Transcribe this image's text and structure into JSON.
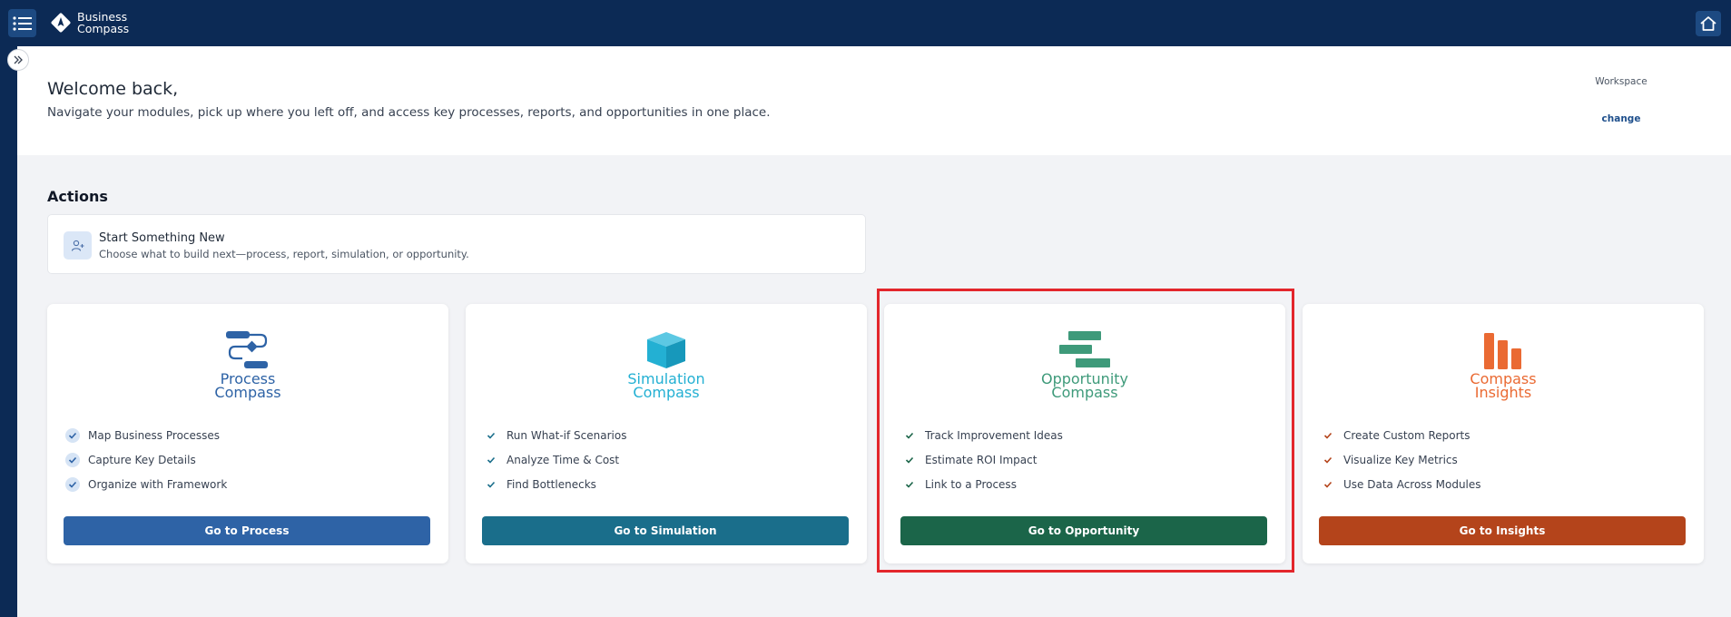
{
  "header": {
    "logo_line1": "Business",
    "logo_line2": "Compass"
  },
  "welcome": {
    "title": "Welcome back,",
    "subtitle": "Navigate your modules, pick up where you left off, and access key processes, reports, and opportunities in one place.",
    "workspace_label": "Workspace",
    "workspace_change": "change"
  },
  "actions": {
    "title": "Actions",
    "start_title": "Start Something New",
    "start_subtitle": "Choose what to build next—process, report, simulation, or opportunity."
  },
  "modules": [
    {
      "name_line1": "Process",
      "name_line2": "Compass",
      "color": "#2e63a6",
      "button_color": "#2e63a6",
      "features": [
        "Map Business Processes",
        "Capture Key Details",
        "Organize with Framework"
      ],
      "button_label": "Go to Process"
    },
    {
      "name_line1": "Simulation",
      "name_line2": "Compass",
      "color": "#23b0d3",
      "button_color": "#1a6e8b",
      "features": [
        "Run What-if Scenarios",
        "Analyze Time & Cost",
        "Find Bottlenecks"
      ],
      "button_label": "Go to Simulation"
    },
    {
      "name_line1": "Opportunity",
      "name_line2": "Compass",
      "color": "#3e9a7a",
      "button_color": "#1b6549",
      "features": [
        "Track Improvement Ideas",
        "Estimate ROI Impact",
        "Link to a Process"
      ],
      "button_label": "Go to Opportunity"
    },
    {
      "name_line1": "Compass",
      "name_line2": "Insights",
      "color": "#ea6a33",
      "button_color": "#b4441b",
      "features": [
        "Create Custom Reports",
        "Visualize Key Metrics",
        "Use Data Across Modules"
      ],
      "button_label": "Go to Insights"
    }
  ],
  "colors": {
    "navbar": "#0c2a55",
    "highlight": "#e3262c"
  }
}
